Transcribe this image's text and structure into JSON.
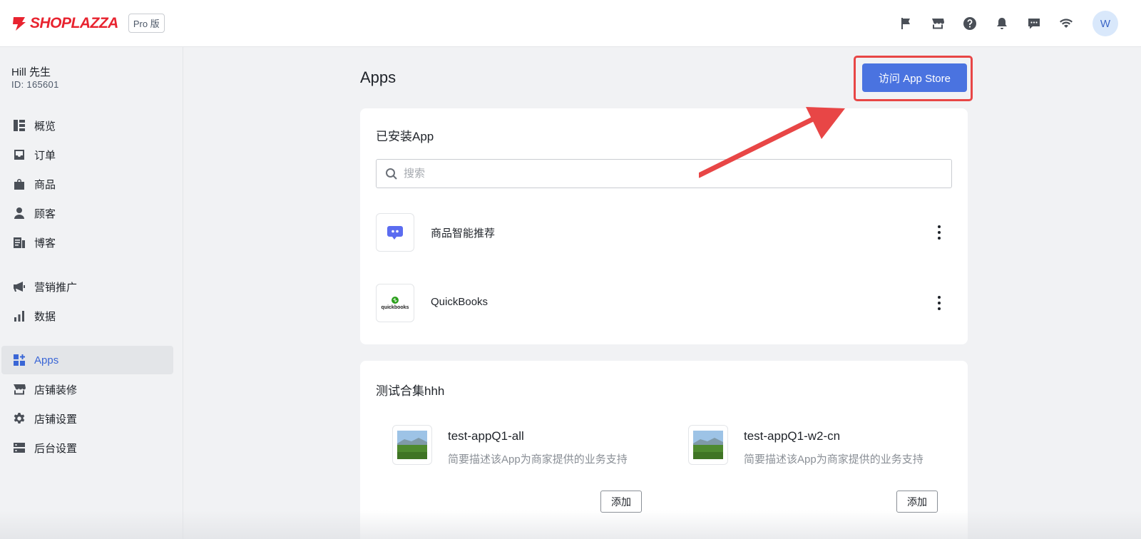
{
  "header": {
    "brand": "SHOPLAZZA",
    "plan": "Pro 版",
    "icons": [
      "flag-icon",
      "store-icon",
      "help-icon",
      "bell-icon",
      "message-icon",
      "wifi-icon"
    ],
    "avatar_initial": "W"
  },
  "account": {
    "name": "Hill 先生",
    "id_text": "ID: 165601"
  },
  "sidebar": {
    "items": [
      {
        "label": "概览",
        "icon": "dashboard-icon"
      },
      {
        "label": "订单",
        "icon": "inbox-icon"
      },
      {
        "label": "商品",
        "icon": "shopping-bag-icon"
      },
      {
        "label": "顾客",
        "icon": "person-icon"
      },
      {
        "label": "博客",
        "icon": "blog-icon"
      },
      {
        "label": "营销推广",
        "icon": "megaphone-icon"
      },
      {
        "label": "数据",
        "icon": "bar-chart-icon"
      },
      {
        "label": "Apps",
        "icon": "apps-icon",
        "active": true
      },
      {
        "label": "店铺装修",
        "icon": "store-icon"
      },
      {
        "label": "店铺设置",
        "icon": "gear-icon"
      },
      {
        "label": "后台设置",
        "icon": "server-icon"
      }
    ]
  },
  "main": {
    "title": "Apps",
    "appstore_button": "访问 App Store",
    "installed": {
      "title": "已安装App",
      "search_placeholder": "搜索",
      "apps": [
        {
          "name": "商品智能推荐",
          "icon": "chat-bubble-icon"
        },
        {
          "name": "QuickBooks",
          "icon": "quickbooks-logo",
          "logo_text": "quickbooks"
        }
      ]
    },
    "collection": {
      "title": "测试合集hhh",
      "items": [
        {
          "name": "test-appQ1-all",
          "desc": "简要描述该App为商家提供的业务支持",
          "add_label": "添加"
        },
        {
          "name": "test-appQ1-w2-cn",
          "desc": "简要描述该App为商家提供的业务支持",
          "add_label": "添加"
        }
      ]
    }
  },
  "colors": {
    "primary": "#4a73e0",
    "brand_red": "#e8232f",
    "highlight": "#e84646",
    "active_nav": "#3a66d6"
  }
}
